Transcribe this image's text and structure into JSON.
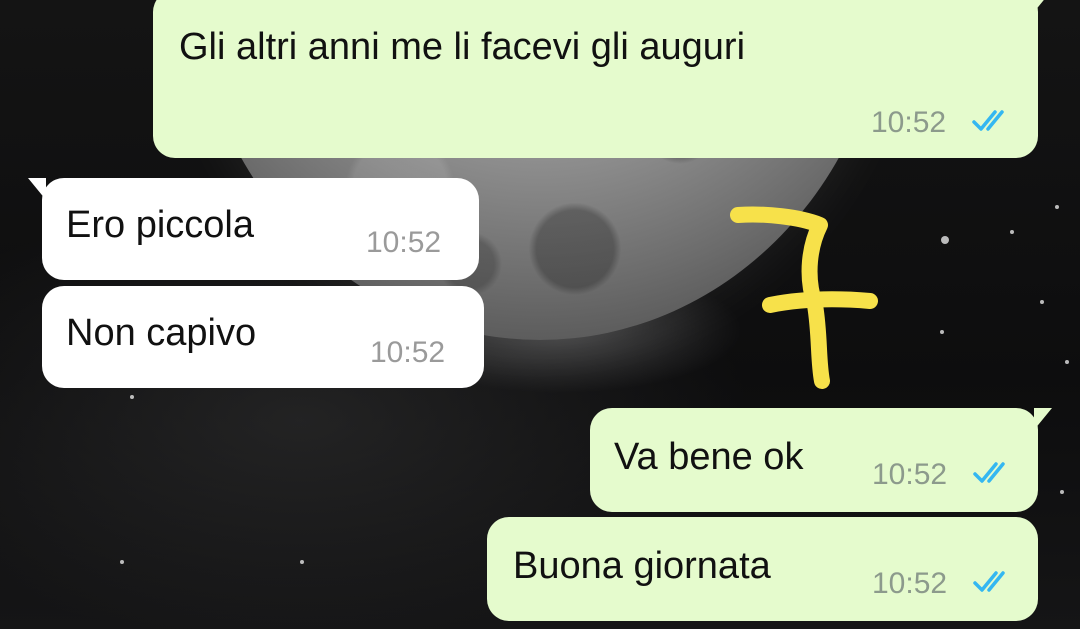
{
  "messages": [
    {
      "text": "Gli altri anni me li facevi gli auguri",
      "time": "10:52",
      "direction": "outgoing",
      "status": "read"
    },
    {
      "text": "Ero piccola",
      "time": "10:52",
      "direction": "incoming"
    },
    {
      "text": "Non capivo",
      "time": "10:52",
      "direction": "incoming"
    },
    {
      "text": "Va bene ok",
      "time": "10:52",
      "direction": "outgoing",
      "status": "read"
    },
    {
      "text": "Buona giornata",
      "time": "10:52",
      "direction": "outgoing",
      "status": "read"
    }
  ],
  "colors": {
    "outgoing_bubble": "#e5fbcd",
    "incoming_bubble": "#ffffff",
    "read_ticks": "#34b7f1",
    "annotation": "#f7e14a"
  },
  "icons": {
    "read_receipt": "double-check-icon"
  }
}
